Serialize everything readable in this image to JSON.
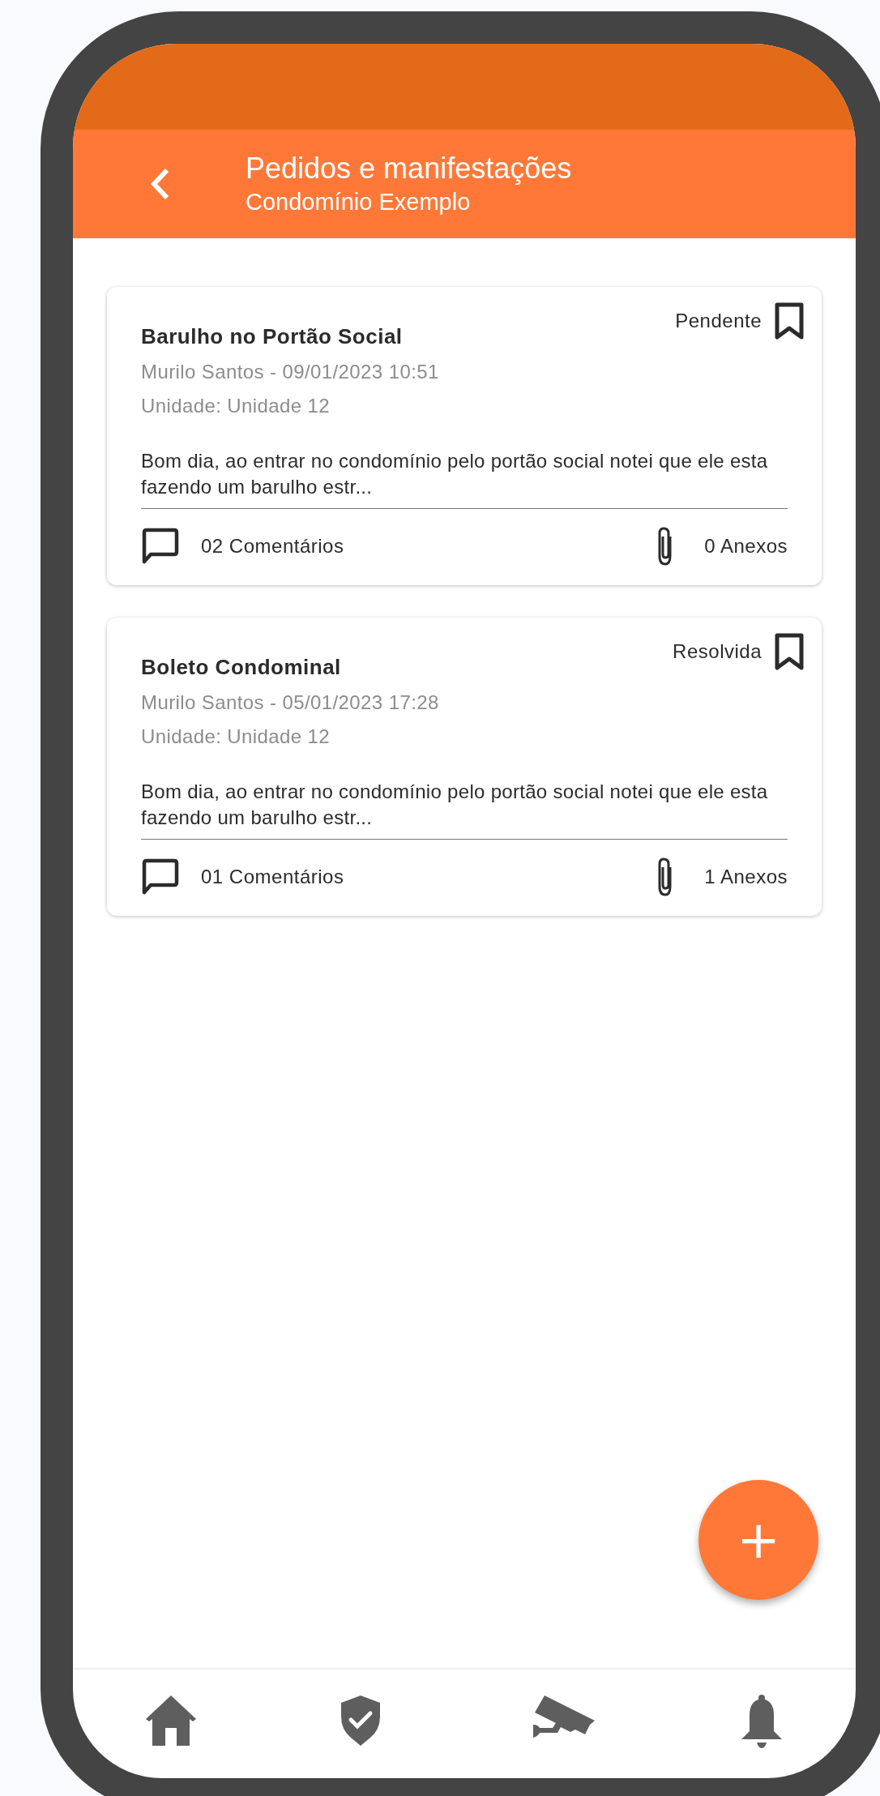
{
  "header": {
    "title": "Pedidos e manifestações",
    "subtitle": "Condomínio Exemplo"
  },
  "requests": [
    {
      "title": "Barulho no Portão Social",
      "status": "Pendente",
      "author_date": "Murilo Santos - 09/01/2023 10:51",
      "unit": "Unidade: Unidade 12",
      "description": "Bom dia, ao entrar no condomínio pelo portão social notei que ele esta fazendo um barulho estr...",
      "comments": "02 Comentários",
      "attachments": "0 Anexos"
    },
    {
      "title": "Boleto Condominal",
      "status": "Resolvida",
      "author_date": "Murilo Santos - 05/01/2023 17:28",
      "unit": "Unidade: Unidade 12",
      "description": "Bom dia, ao entrar no condomínio pelo portão social notei que ele esta fazendo um barulho estr...",
      "comments": "01 Comentários",
      "attachments": "1 Anexos"
    }
  ],
  "fab": {
    "label": "+"
  },
  "bottom_nav": [
    {
      "kind": "home"
    },
    {
      "kind": "shield"
    },
    {
      "kind": "camera"
    },
    {
      "kind": "bell"
    }
  ]
}
